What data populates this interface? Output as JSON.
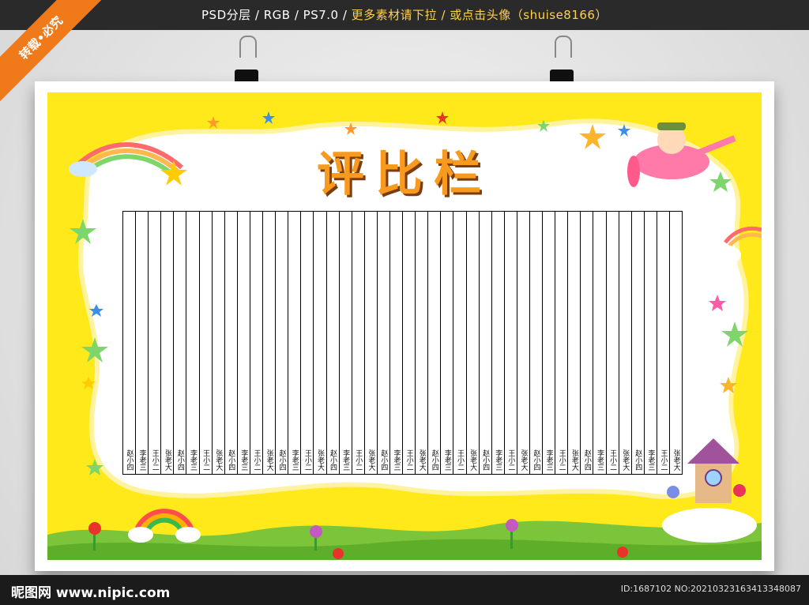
{
  "topbar": {
    "specs": "PSD分层 / RGB / PS7.0 / ",
    "promo": "更多素材请下拉 / 或点击头像（shuise8166）"
  },
  "ribbon": {
    "label": "转载•必究"
  },
  "poster": {
    "title": "评比栏",
    "names": [
      "赵小四",
      "李老三",
      "王小二",
      "张老大",
      "赵小四",
      "李老三",
      "王小二",
      "张老大",
      "赵小四",
      "李老三",
      "王小二",
      "张老大",
      "赵小四",
      "李老三",
      "王小二",
      "张老大",
      "赵小四",
      "李老三",
      "王小二",
      "张老大",
      "赵小四",
      "李老三",
      "王小二",
      "张老大",
      "赵小四",
      "李老三",
      "王小二",
      "张老大",
      "赵小四",
      "李老三",
      "王小二",
      "张老大",
      "赵小四",
      "李老三",
      "王小二",
      "张老大",
      "赵小四",
      "李老三",
      "王小二",
      "张老大",
      "赵小四",
      "李老三",
      "王小二",
      "张老大"
    ]
  },
  "footer": {
    "logo": "昵图网 www.nipic.com",
    "id": "ID:1687102 NO:20210323163413348087"
  },
  "colors": {
    "poster_bg": "#ffe91a",
    "title": "#f79a1e",
    "ribbon": "#f07a1a"
  }
}
